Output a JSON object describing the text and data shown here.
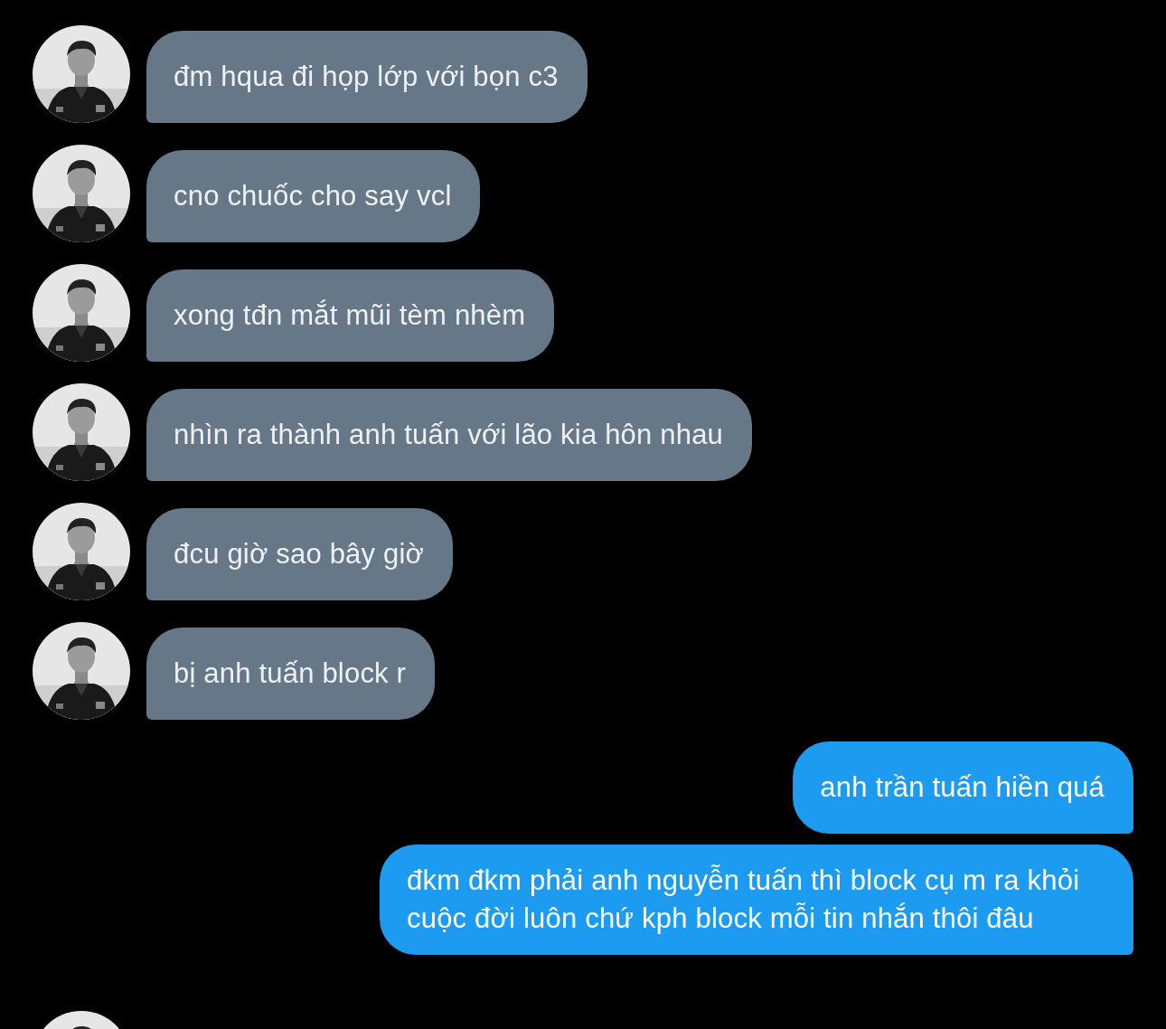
{
  "messages": [
    {
      "kind": "incoming",
      "text": "đm hqua đi họp lớp với bọn c3"
    },
    {
      "kind": "incoming",
      "text": "cno chuốc cho say vcl"
    },
    {
      "kind": "incoming",
      "text": "xong tđn mắt mũi tèm nhèm"
    },
    {
      "kind": "incoming",
      "text": "nhìn ra thành anh tuấn với lão kia hôn nhau"
    },
    {
      "kind": "incoming",
      "text": "đcu giờ sao bây giờ"
    },
    {
      "kind": "incoming",
      "text": "bị anh tuấn block r"
    },
    {
      "kind": "outgoing",
      "text": "anh trần tuấn hiền quá"
    },
    {
      "kind": "outgoing",
      "text": "đkm đkm phải anh nguyễn tuấn thì block cụ m ra khỏi cuộc đời luôn chứ kph block mỗi tin nhắn thôi đâu"
    }
  ]
}
